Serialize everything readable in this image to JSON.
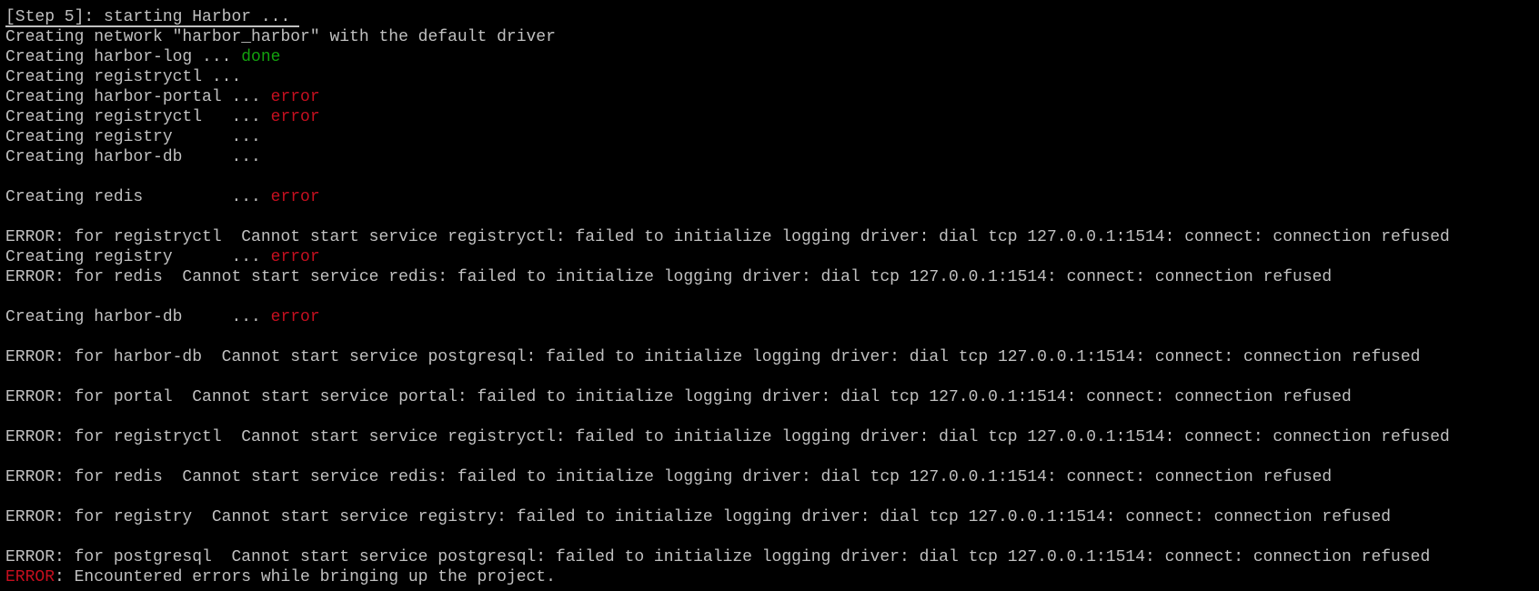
{
  "terminal": {
    "colors": {
      "background": "#000000",
      "text": "#c0c0c0",
      "ok": "#13a10e",
      "error": "#c50f1f"
    },
    "lines": [
      {
        "text": "[Step 5]: starting Harbor ..."
      },
      {
        "text": "Creating network ″harbor_harbor″ with the default driver"
      },
      {
        "text": "Creating harbor-log ... ",
        "status": "done"
      },
      {
        "text": "Creating registryctl ..."
      },
      {
        "text": "Creating harbor-portal ... ",
        "status": "error"
      },
      {
        "text": "Creating registryctl   ... ",
        "status": "error"
      },
      {
        "text": "Creating registry      ..."
      },
      {
        "text": "Creating harbor-db     ..."
      },
      {
        "text": ""
      },
      {
        "text": "Creating redis         ... ",
        "status": "error"
      },
      {
        "text": ""
      },
      {
        "text": "ERROR: for registryctl  Cannot start service registryctl: failed to initialize logging driver: dial tcp 127.0.0.1:1514: connect: connection refused"
      },
      {
        "text": "Creating registry      ... ",
        "status": "error"
      },
      {
        "text": "ERROR: for redis  Cannot start service redis: failed to initialize logging driver: dial tcp 127.0.0.1:1514: connect: connection refused"
      },
      {
        "text": ""
      },
      {
        "text": "Creating harbor-db     ... ",
        "status": "error"
      },
      {
        "text": ""
      },
      {
        "text": "ERROR: for harbor-db  Cannot start service postgresql: failed to initialize logging driver: dial tcp 127.0.0.1:1514: connect: connection refused"
      },
      {
        "text": ""
      },
      {
        "text": "ERROR: for portal  Cannot start service portal: failed to initialize logging driver: dial tcp 127.0.0.1:1514: connect: connection refused"
      },
      {
        "text": ""
      },
      {
        "text": "ERROR: for registryctl  Cannot start service registryctl: failed to initialize logging driver: dial tcp 127.0.0.1:1514: connect: connection refused"
      },
      {
        "text": ""
      },
      {
        "text": "ERROR: for redis  Cannot start service redis: failed to initialize logging driver: dial tcp 127.0.0.1:1514: connect: connection refused"
      },
      {
        "text": ""
      },
      {
        "text": "ERROR: for registry  Cannot start service registry: failed to initialize logging driver: dial tcp 127.0.0.1:1514: connect: connection refused"
      },
      {
        "text": ""
      },
      {
        "text": "ERROR: for postgresql  Cannot start service postgresql: failed to initialize logging driver: dial tcp 127.0.0.1:1514: connect: connection refused"
      },
      {
        "prefix": "ERROR",
        "text": ": Encountered errors while bringing up the project."
      }
    ]
  }
}
